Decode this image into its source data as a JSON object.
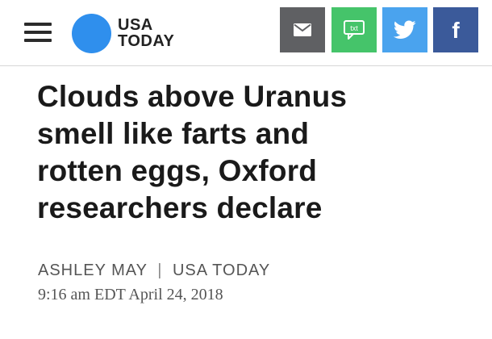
{
  "header": {
    "logo": {
      "line1": "USA",
      "line2": "TODAY",
      "color": "#2f8fed"
    },
    "share_buttons": [
      {
        "name": "email",
        "icon": "envelope-icon",
        "color": "#5f6063"
      },
      {
        "name": "sms",
        "icon": "txt-bubble-icon",
        "label": "txt",
        "color": "#45c46a"
      },
      {
        "name": "twitter",
        "icon": "twitter-bird-icon",
        "color": "#4aa3ee"
      },
      {
        "name": "facebook",
        "icon": "facebook-f-icon",
        "label": "f",
        "color": "#3b5a9a"
      }
    ]
  },
  "article": {
    "headline_lines": [
      "Clouds above Uranus",
      "smell like farts and",
      "rotten eggs, Oxford",
      "researchers declare"
    ],
    "author": "ASHLEY MAY",
    "separator": "|",
    "publication": "USA TODAY",
    "timestamp": "9:16 am EDT April 24, 2018"
  }
}
